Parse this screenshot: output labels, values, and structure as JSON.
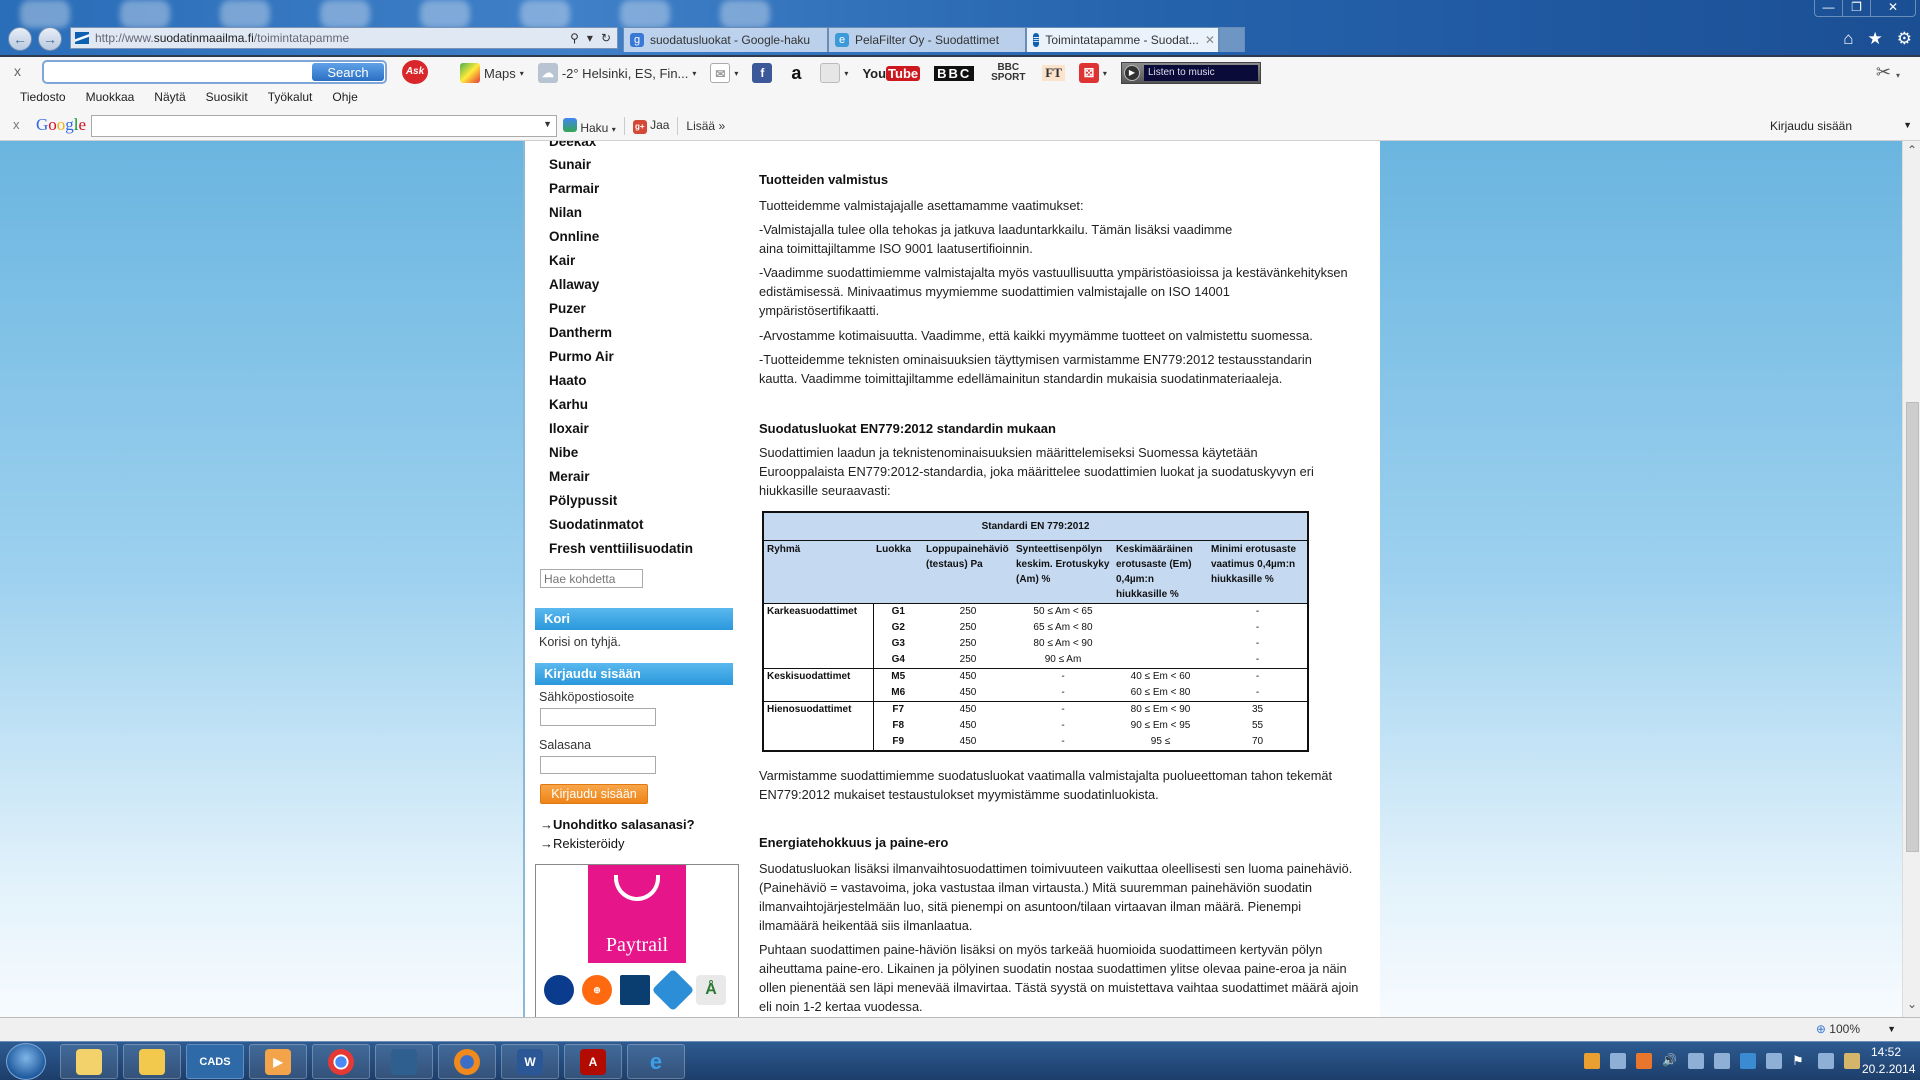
{
  "browser": {
    "window_controls": {
      "minimize": "—",
      "restore": "❐",
      "close": "✕"
    },
    "address": {
      "prefix": "http://www.",
      "domain": "suodatinmaailma.fi",
      "path": "/toimintatapamme"
    },
    "tabs": [
      {
        "label": "suodatusluokat - Google-haku",
        "icon": "google-icon",
        "active": false
      },
      {
        "label": "PelaFilter Oy - Suodattimet",
        "icon": "ie-icon",
        "active": false
      },
      {
        "label": "Toimintatapamme - Suodat...",
        "icon": "site-icon",
        "active": true
      }
    ],
    "right_icons": [
      "home-icon",
      "star-icon",
      "gear-icon"
    ]
  },
  "ask_toolbar": {
    "close": "x",
    "search_value": "",
    "search_button": "Search",
    "ask_logo": "Ask",
    "items": {
      "maps": "Maps",
      "weather": "-2° Helsinki, ES, Fin...",
      "bbc": "BBC",
      "bbc_sport": "BBC SPORT",
      "ft": "FT",
      "music": "Listen to music"
    }
  },
  "menubar": [
    "Tiedosto",
    "Muokkaa",
    "Näytä",
    "Suosikit",
    "Työkalut",
    "Ohje"
  ],
  "google_toolbar": {
    "close": "x",
    "logo": "Google",
    "search_value": "",
    "haku": "Haku",
    "jaa": "Jaa",
    "lisaa": "Lisää »",
    "login": "Kirjaudu sisään"
  },
  "sidebar": {
    "partial_item": "Deekax",
    "categories": [
      "Sunair",
      "Parmair",
      "Nilan",
      "Onnline",
      "Kair",
      "Allaway",
      "Puzer",
      "Dantherm",
      "Purmo Air",
      "Haato",
      "Karhu",
      "Iloxair",
      "Nibe",
      "Merair",
      "Pölypussit",
      "Suodatinmatot",
      "Fresh venttiilisuodatin"
    ],
    "search_placeholder": "Hae kohdetta",
    "cart": {
      "title": "Kori",
      "text": "Korisi on tyhjä."
    },
    "login": {
      "title": "Kirjaudu sisään",
      "email_label": "Sähköpostiosoite",
      "email_value": "",
      "password_label": "Salasana",
      "password_value": "",
      "button": "Kirjaudu sisään",
      "forgot": "Unohditko salasanasi?",
      "register": "Rekisteröidy"
    },
    "payment": {
      "brand": "Paytrail",
      "banks": [
        "Nordea",
        "OP",
        "Danske Bank",
        "S-Pankki",
        "Ålandsbanken"
      ]
    }
  },
  "main": {
    "s1_title": "Tuotteiden valmistus",
    "s1_p1": "Tuotteidemme valmistajajalle asettamamme vaatimukset:",
    "s1_p2a": "-Valmistajalla tulee olla tehokas ja jatkuva laaduntarkkailu. Tämän lisäksi vaadimme",
    "s1_p2b": "aina toimittajiltamme ISO 9001 laatusertifioinnin.",
    "s1_p3": "-Vaadimme suodattimiemme valmistajalta myös vastuullisuutta ympäristöasioissa ja kestävänkehityksen edistämisessä. Minivaatimus myymiemme suodattimien valmistajalle on  ISO 14001 ympäristösertifikaatti.",
    "s1_p4": "-Arvostamme kotimaisuutta. Vaadimme, että kaikki myymämme tuotteet on valmistettu suomessa.",
    "s1_p5": "-Tuotteidemme teknisten ominaisuuksien täyttymisen varmistamme EN779:2012 testausstandarin kautta. Vaadimme toimittajiltamme edellämainitun standardin mukaisia suodatinmateriaaleja.",
    "s2_title": "Suodatusluokat EN779:2012 standardin mukaan",
    "s2_p1": "Suodattimien laadun ja teknistenominaisuuksien määrittelemiseksi Suomessa käytetään Eurooppalaista EN779:2012-standardia, joka  määrittelee suodattimien luokat ja suodatuskyvyn eri hiukkasille seuraavasti:",
    "table": {
      "caption": "Standardi EN 779:2012",
      "headers": [
        "Ryhmä",
        "Luokka",
        "Loppupainehäviö (testaus) Pa",
        "Synteettisenpölyn keskim. Erotuskyky (Am) %",
        "Keskimääräinen erotusaste (Em) 0,4µm:n hiukkasille %",
        "Minimi erotusaste vaatimus 0,4µm:n hiukkasille %"
      ],
      "rows": [
        {
          "group": "Karkeasuodattimet",
          "class": "G1",
          "pa": "250",
          "am": "50 ≤ Am < 65",
          "em": "",
          "min": "-"
        },
        {
          "group": "",
          "class": "G2",
          "pa": "250",
          "am": "65 ≤ Am < 80",
          "em": "",
          "min": "-"
        },
        {
          "group": "",
          "class": "G3",
          "pa": "250",
          "am": "80 ≤ Am < 90",
          "em": "",
          "min": "-"
        },
        {
          "group": "",
          "class": "G4",
          "pa": "250",
          "am": "90 ≤ Am",
          "em": "",
          "min": "-"
        },
        {
          "group": "Keskisuodattimet",
          "class": "M5",
          "pa": "450",
          "am": "-",
          "em": "40 ≤ Em < 60",
          "min": "-"
        },
        {
          "group": "",
          "class": "M6",
          "pa": "450",
          "am": "-",
          "em": "60 ≤ Em < 80",
          "min": "-"
        },
        {
          "group": "Hienosuodattimet",
          "class": "F7",
          "pa": "450",
          "am": "-",
          "em": "80 ≤ Em < 90",
          "min": "35"
        },
        {
          "group": "",
          "class": "F8",
          "pa": "450",
          "am": "-",
          "em": "90 ≤ Em < 95",
          "min": "55"
        },
        {
          "group": "",
          "class": "F9",
          "pa": "450",
          "am": "-",
          "em": "95 ≤",
          "min": "70"
        }
      ]
    },
    "s2_p2": "Varmistamme suodattimiemme suodatusluokat vaatimalla valmistajalta puolueettoman tahon tekemät EN779:2012 mukaiset testaustulokset myymistämme suodatinluokista.",
    "s3_title": "Energiatehokkuus ja paine-ero",
    "s3_p1": "Suodatusluokan lisäksi ilmanvaihtosuodattimen toimivuuteen vaikuttaa oleellisesti sen luoma painehäviö. (Painehäviö = vastavoima, joka vastustaa ilman virtausta.) Mitä suuremman painehäviön suodatin ilmanvaihtojärjestelmään luo, sitä pienempi on asuntoon/tilaan virtaavan ilman määrä. Pienempi ilmamäärä heikentää siis ilmanlaatua.",
    "s3_p2": "Puhtaan suodattimen paine-häviön lisäksi on myös tarkeää huomioida suodattimeen kertyvän pölyn aiheuttama paine-ero. Likainen ja pölyinen suodatin nostaa suodattimen ylitse olevaa paine-eroa ja näin ollen pienentää sen läpi menevää ilmavirtaa. Tästä syystä on muistettava vaihtaa suodattimet määrä ajoin eli noin 1-2 kertaa vuodessa."
  },
  "statusbar": {
    "zoom": "100%"
  },
  "taskbar": {
    "apps": [
      "Windows Explorer",
      "Outlook",
      "CADS",
      "Media Player",
      "Chrome",
      "File",
      "Firefox",
      "Word",
      "Acrobat",
      "Internet Explorer"
    ],
    "cads_label": "CADS",
    "time": "14:52",
    "date": "20.2.2014"
  }
}
